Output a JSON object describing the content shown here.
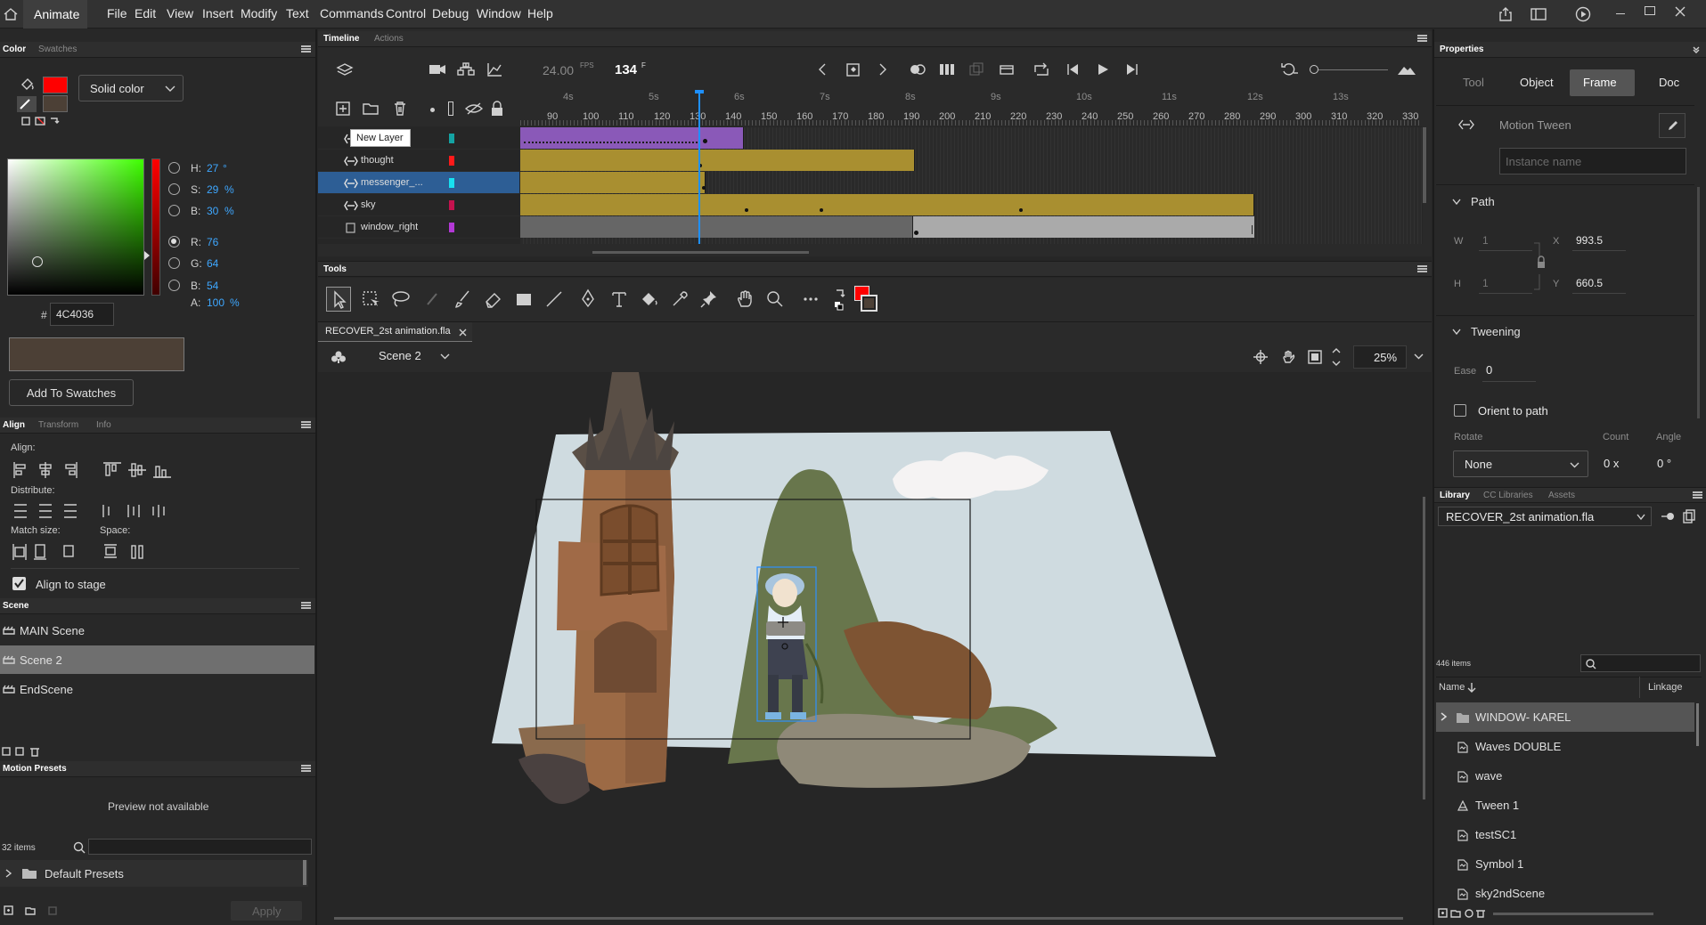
{
  "app": {
    "name": "Animate"
  },
  "menu": [
    "File",
    "Edit",
    "View",
    "Insert",
    "Modify",
    "Text",
    "Commands",
    "Control",
    "Debug",
    "Window",
    "Help"
  ],
  "color_panel": {
    "tabs": [
      "Color",
      "Swatches"
    ],
    "fill_type": "Solid color",
    "hsb": [
      {
        "k": "H:",
        "v": "27",
        "u": "°"
      },
      {
        "k": "S:",
        "v": "29",
        "u": "%"
      },
      {
        "k": "B:",
        "v": "30",
        "u": "%"
      }
    ],
    "rgb": [
      {
        "k": "R:",
        "v": "76"
      },
      {
        "k": "G:",
        "v": "64"
      },
      {
        "k": "B:",
        "v": "54"
      },
      {
        "k": "A:",
        "v": "100",
        "u": "%"
      }
    ],
    "hex_label": "#",
    "hex": "4C4036",
    "add_swatches": "Add To Swatches",
    "selected_color": "#4c4036",
    "stroke_color": "#ff0000"
  },
  "align_panel": {
    "tabs": [
      "Align",
      "Transform",
      "Info"
    ],
    "align_label": "Align:",
    "distribute_label": "Distribute:",
    "match_size_label": "Match size:",
    "space_label": "Space:",
    "align_to_stage": "Align to stage"
  },
  "scene_panel": {
    "title": "Scene",
    "scenes": [
      "MAIN Scene",
      "Scene 2",
      "EndScene"
    ],
    "selected": 1
  },
  "motion_presets": {
    "title": "Motion Presets",
    "preview": "Preview not available",
    "count": "32 items",
    "folder": "Default Presets",
    "apply": "Apply"
  },
  "timeline": {
    "tabs": [
      "Timeline",
      "Actions"
    ],
    "fps": "24.00",
    "fps_unit": "FPS",
    "frame": "134",
    "frame_unit": "F",
    "tooltip": "New Layer",
    "seconds": [
      "4s",
      "5s",
      "6s",
      "7s",
      "8s",
      "9s",
      "10s",
      "11s",
      "12s",
      "13s"
    ],
    "frame_numbers": [
      "90",
      "100",
      "110",
      "120",
      "130",
      "140",
      "150",
      "160",
      "170",
      "180",
      "190",
      "200",
      "210",
      "220",
      "230",
      "240",
      "250",
      "260",
      "270",
      "280",
      "290",
      "300",
      "310",
      "320",
      "330"
    ],
    "layers": [
      {
        "name": "",
        "color": "#14a3a3"
      },
      {
        "name": "thought",
        "color": "#ff1a1a"
      },
      {
        "name": "messenger_...",
        "color": "#18e0f0"
      },
      {
        "name": "sky",
        "color": "#c4124e"
      },
      {
        "name": "window_right",
        "color": "#b338d6"
      }
    ]
  },
  "tools_panel": {
    "title": "Tools"
  },
  "document": {
    "tab": "RECOVER_2st animation.fla",
    "scene": "Scene 2",
    "zoom": "25%"
  },
  "properties": {
    "title": "Properties",
    "tabs": [
      "Tool",
      "Object",
      "Frame",
      "Doc"
    ],
    "active_tab": "Frame",
    "type": "Motion Tween",
    "instance_placeholder": "Instance name",
    "path_title": "Path",
    "w_label": "W",
    "w": "1",
    "h_label": "H",
    "h": "1",
    "x_label": "X",
    "x": "993.5",
    "y_label": "Y",
    "y": "660.5",
    "tweening_title": "Tweening",
    "ease_label": "Ease",
    "ease": "0",
    "orient_label": "Orient to path",
    "rotate_label": "Rotate",
    "rotate": "None",
    "count_label": "Count",
    "count": "0 x",
    "angle_label": "Angle",
    "angle": "0 °"
  },
  "library": {
    "tabs": [
      "Library",
      "CC Libraries",
      "Assets"
    ],
    "file": "RECOVER_2st animation.fla",
    "count": "446 items",
    "col_name": "Name",
    "col_linkage": "Linkage",
    "items": [
      {
        "name": "WINDOW- KAREL",
        "type": "folder"
      },
      {
        "name": "Waves DOUBLE",
        "type": "symbol"
      },
      {
        "name": "wave",
        "type": "symbol"
      },
      {
        "name": "Tween 1",
        "type": "graphic"
      },
      {
        "name": "testSC1",
        "type": "symbol"
      },
      {
        "name": "Symbol 1",
        "type": "symbol"
      },
      {
        "name": "sky2ndScene",
        "type": "symbol"
      }
    ]
  }
}
